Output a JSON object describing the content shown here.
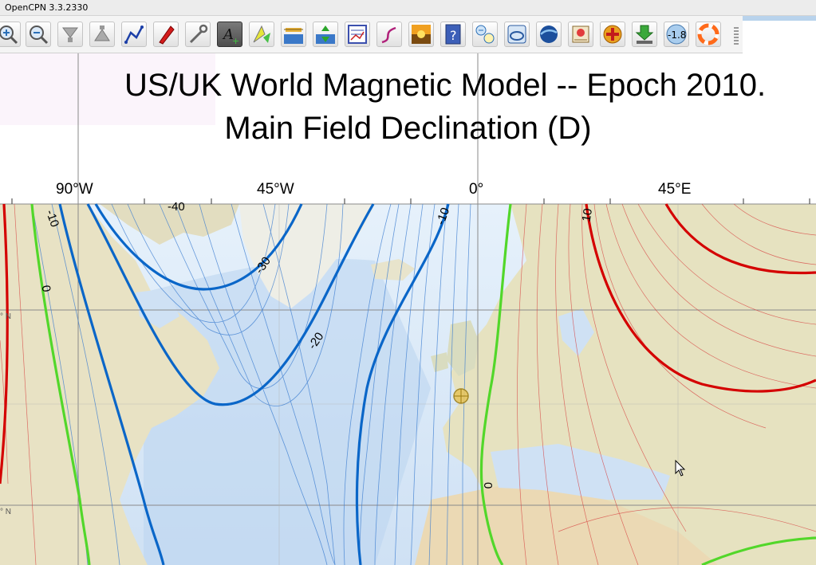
{
  "window": {
    "title": "OpenCPN 3.3.2330"
  },
  "toolbar": {
    "buttons": [
      {
        "name": "zoom-in-icon",
        "interactable": true
      },
      {
        "name": "zoom-out-icon",
        "interactable": true
      },
      {
        "name": "scale-down-icon",
        "interactable": true
      },
      {
        "name": "scale-up-icon",
        "interactable": true
      },
      {
        "name": "route-icon",
        "interactable": true
      },
      {
        "name": "ship-icon",
        "interactable": true
      },
      {
        "name": "settings-wrench-icon",
        "interactable": true
      },
      {
        "name": "text-tool-icon",
        "interactable": true,
        "active": true
      },
      {
        "name": "current-icon",
        "interactable": true
      },
      {
        "name": "tides-icon",
        "interactable": true
      },
      {
        "name": "currents-icon",
        "interactable": true
      },
      {
        "name": "chart-quilt-icon",
        "interactable": true
      },
      {
        "name": "track-icon",
        "interactable": true
      },
      {
        "name": "color-scheme-icon",
        "interactable": true
      },
      {
        "name": "help-icon",
        "interactable": true
      },
      {
        "name": "ais-icon",
        "interactable": true
      },
      {
        "name": "chart-catalog-icon",
        "interactable": true
      },
      {
        "name": "google-earth-icon",
        "interactable": true
      },
      {
        "name": "logbook-icon",
        "interactable": true
      },
      {
        "name": "mob-target-icon",
        "interactable": true
      },
      {
        "name": "download-icon",
        "interactable": true
      },
      {
        "name": "magnetic-variation-icon",
        "interactable": true,
        "text": "-1.8"
      },
      {
        "name": "lifebuoy-icon",
        "interactable": true
      }
    ]
  },
  "map": {
    "title_line1": "US/UK World Magnetic Model -- Epoch 2010.",
    "title_line2": "Main Field Declination (D)",
    "longitude_labels": [
      "90°W",
      "45°W",
      "0°",
      "45°E"
    ],
    "latitude_labels": [
      "° N",
      "° N"
    ],
    "contour_labels": [
      "-40",
      "-30",
      "-20",
      "-10",
      "-10",
      "0",
      "0",
      "10"
    ],
    "colors": {
      "negative": "#0a66c8",
      "zero": "#52d72a",
      "positive": "#d40000"
    }
  }
}
